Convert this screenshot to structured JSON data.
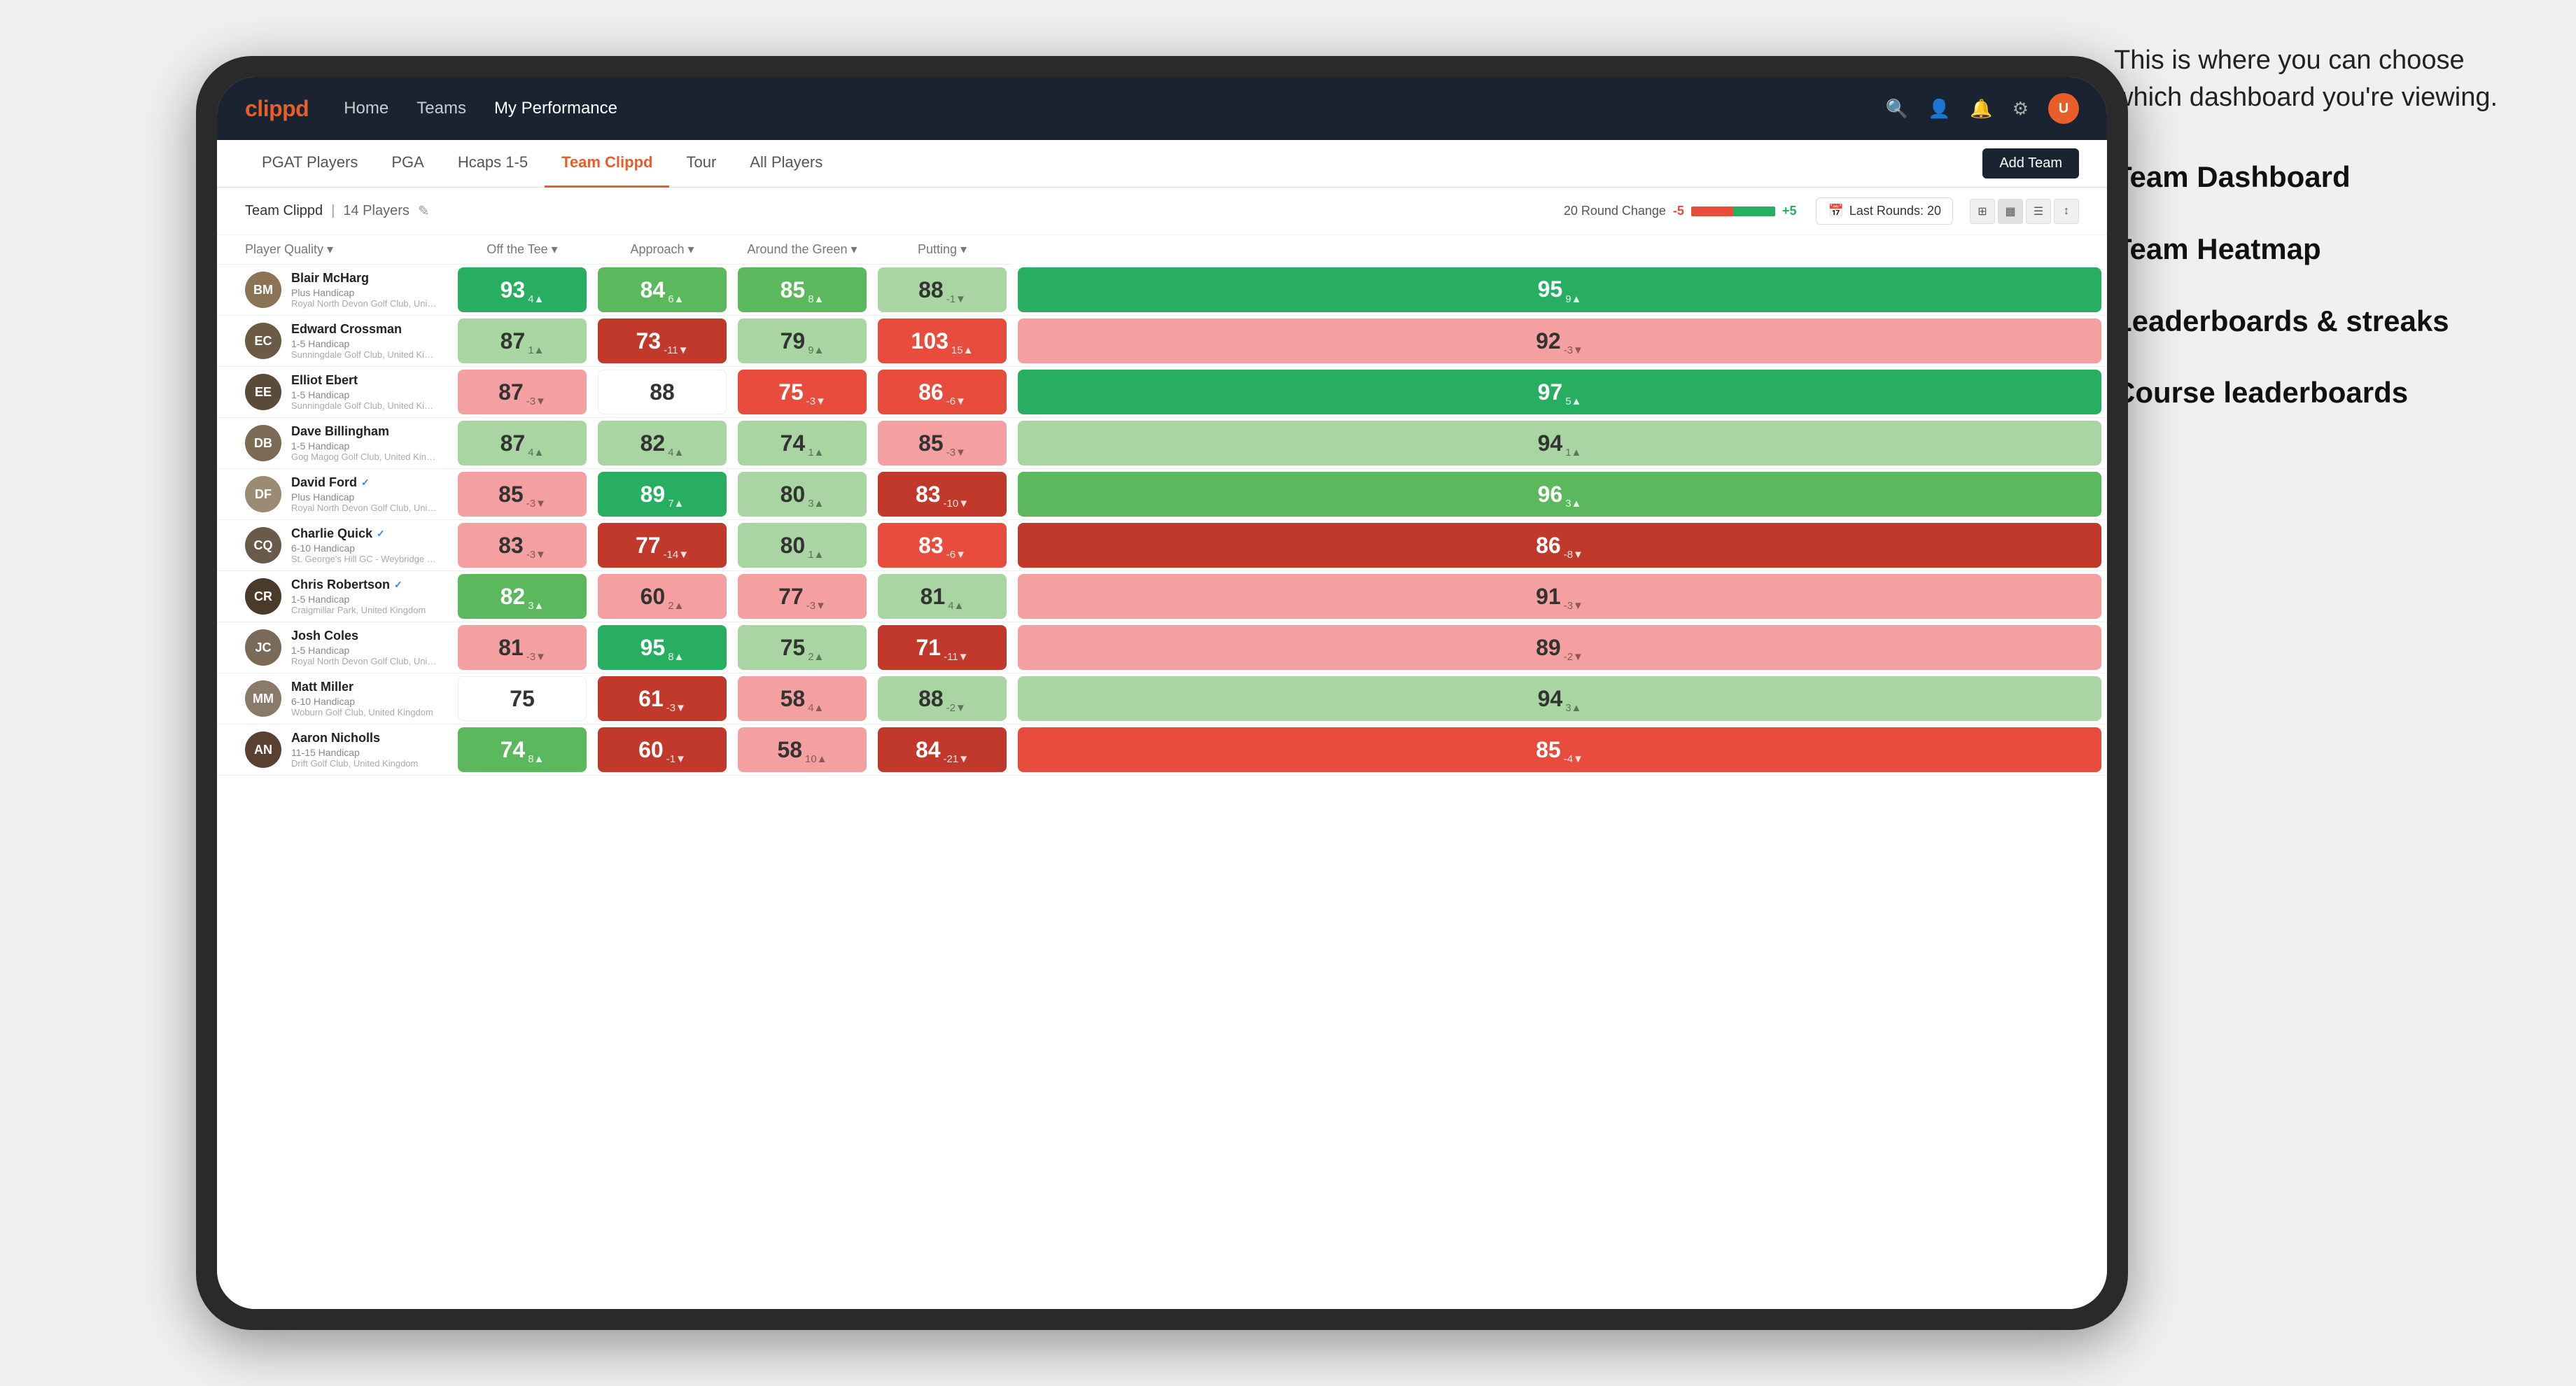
{
  "annotation": {
    "intro_text": "This is where you can choose which dashboard you're viewing.",
    "options": [
      "Team Dashboard",
      "Team Heatmap",
      "Leaderboards & streaks",
      "Course leaderboards"
    ]
  },
  "nav": {
    "logo": "clippd",
    "links": [
      "Home",
      "Teams",
      "My Performance"
    ],
    "active_link": "My Performance",
    "icons": [
      "🔍",
      "👤",
      "🔔",
      "⚙"
    ]
  },
  "sub_nav": {
    "tabs": [
      "PGAT Players",
      "PGA",
      "Hcaps 1-5",
      "Team Clippd",
      "Tour",
      "All Players"
    ],
    "active_tab": "Team Clippd",
    "add_team_label": "Add Team"
  },
  "team_bar": {
    "team_name": "Team Clippd",
    "separator": "|",
    "players_count": "14 Players",
    "round_change_label": "20 Round Change",
    "round_neg": "-5",
    "round_pos": "+5",
    "last_rounds_label": "Last Rounds:",
    "last_rounds_count": "20"
  },
  "table": {
    "headers": [
      {
        "label": "Player Quality ▾",
        "key": "player_quality"
      },
      {
        "label": "Off the Tee ▾",
        "key": "off_tee"
      },
      {
        "label": "Approach ▾",
        "key": "approach"
      },
      {
        "label": "Around the Green ▾",
        "key": "around_green"
      },
      {
        "label": "Putting ▾",
        "key": "putting"
      }
    ],
    "players": [
      {
        "name": "Blair McHarg",
        "handicap": "Plus Handicap",
        "club": "Royal North Devon Golf Club, United Kingdom",
        "verified": false,
        "avatar_color": "#8B7355",
        "scores": [
          {
            "value": "93",
            "change": "4▲",
            "color": "green-strong"
          },
          {
            "value": "84",
            "change": "6▲",
            "color": "green-mid"
          },
          {
            "value": "85",
            "change": "8▲",
            "color": "green-mid"
          },
          {
            "value": "88",
            "change": "-1▼",
            "color": "green-light"
          },
          {
            "value": "95",
            "change": "9▲",
            "color": "green-strong"
          }
        ]
      },
      {
        "name": "Edward Crossman",
        "handicap": "1-5 Handicap",
        "club": "Sunningdale Golf Club, United Kingdom",
        "verified": false,
        "avatar_color": "#6B5B45",
        "scores": [
          {
            "value": "87",
            "change": "1▲",
            "color": "green-light"
          },
          {
            "value": "73",
            "change": "-11▼",
            "color": "red-strong"
          },
          {
            "value": "79",
            "change": "9▲",
            "color": "green-light"
          },
          {
            "value": "103",
            "change": "15▲",
            "color": "red-mid"
          },
          {
            "value": "92",
            "change": "-3▼",
            "color": "red-light"
          }
        ]
      },
      {
        "name": "Elliot Ebert",
        "handicap": "1-5 Handicap",
        "club": "Sunningdale Golf Club, United Kingdom",
        "verified": false,
        "avatar_color": "#5a4a3a",
        "scores": [
          {
            "value": "87",
            "change": "-3▼",
            "color": "red-light"
          },
          {
            "value": "88",
            "change": "",
            "color": "white"
          },
          {
            "value": "75",
            "change": "-3▼",
            "color": "red-mid"
          },
          {
            "value": "86",
            "change": "-6▼",
            "color": "red-mid"
          },
          {
            "value": "97",
            "change": "5▲",
            "color": "green-strong"
          }
        ]
      },
      {
        "name": "Dave Billingham",
        "handicap": "1-5 Handicap",
        "club": "Gog Magog Golf Club, United Kingdom",
        "verified": false,
        "avatar_color": "#7B6B55",
        "scores": [
          {
            "value": "87",
            "change": "4▲",
            "color": "green-light"
          },
          {
            "value": "82",
            "change": "4▲",
            "color": "green-light"
          },
          {
            "value": "74",
            "change": "1▲",
            "color": "green-light"
          },
          {
            "value": "85",
            "change": "-3▼",
            "color": "red-light"
          },
          {
            "value": "94",
            "change": "1▲",
            "color": "green-light"
          }
        ]
      },
      {
        "name": "David Ford",
        "handicap": "Plus Handicap",
        "club": "Royal North Devon Golf Club, United Kingdom",
        "verified": true,
        "avatar_color": "#9B8B75",
        "scores": [
          {
            "value": "85",
            "change": "-3▼",
            "color": "red-light"
          },
          {
            "value": "89",
            "change": "7▲",
            "color": "green-strong"
          },
          {
            "value": "80",
            "change": "3▲",
            "color": "green-light"
          },
          {
            "value": "83",
            "change": "-10▼",
            "color": "red-strong"
          },
          {
            "value": "96",
            "change": "3▲",
            "color": "green-mid"
          }
        ]
      },
      {
        "name": "Charlie Quick",
        "handicap": "6-10 Handicap",
        "club": "St. George's Hill GC - Weybridge - Surrey, Uni...",
        "verified": true,
        "avatar_color": "#6a5a4a",
        "scores": [
          {
            "value": "83",
            "change": "-3▼",
            "color": "red-light"
          },
          {
            "value": "77",
            "change": "-14▼",
            "color": "red-strong"
          },
          {
            "value": "80",
            "change": "1▲",
            "color": "green-light"
          },
          {
            "value": "83",
            "change": "-6▼",
            "color": "red-mid"
          },
          {
            "value": "86",
            "change": "-8▼",
            "color": "red-strong"
          }
        ]
      },
      {
        "name": "Chris Robertson",
        "handicap": "1-5 Handicap",
        "club": "Craigmillar Park, United Kingdom",
        "verified": true,
        "avatar_color": "#4a3a2a",
        "scores": [
          {
            "value": "82",
            "change": "3▲",
            "color": "green-mid"
          },
          {
            "value": "60",
            "change": "2▲",
            "color": "red-light"
          },
          {
            "value": "77",
            "change": "-3▼",
            "color": "red-light"
          },
          {
            "value": "81",
            "change": "4▲",
            "color": "green-light"
          },
          {
            "value": "91",
            "change": "-3▼",
            "color": "red-light"
          }
        ]
      },
      {
        "name": "Josh Coles",
        "handicap": "1-5 Handicap",
        "club": "Royal North Devon Golf Club, United Kingdom",
        "verified": false,
        "avatar_color": "#7a6a5a",
        "scores": [
          {
            "value": "81",
            "change": "-3▼",
            "color": "red-light"
          },
          {
            "value": "95",
            "change": "8▲",
            "color": "green-strong"
          },
          {
            "value": "75",
            "change": "2▲",
            "color": "green-light"
          },
          {
            "value": "71",
            "change": "-11▼",
            "color": "red-strong"
          },
          {
            "value": "89",
            "change": "-2▼",
            "color": "red-light"
          }
        ]
      },
      {
        "name": "Matt Miller",
        "handicap": "6-10 Handicap",
        "club": "Woburn Golf Club, United Kingdom",
        "verified": false,
        "avatar_color": "#8a7a6a",
        "scores": [
          {
            "value": "75",
            "change": "",
            "color": "white"
          },
          {
            "value": "61",
            "change": "-3▼",
            "color": "red-strong"
          },
          {
            "value": "58",
            "change": "4▲",
            "color": "red-light"
          },
          {
            "value": "88",
            "change": "-2▼",
            "color": "green-light"
          },
          {
            "value": "94",
            "change": "3▲",
            "color": "green-light"
          }
        ]
      },
      {
        "name": "Aaron Nicholls",
        "handicap": "11-15 Handicap",
        "club": "Drift Golf Club, United Kingdom",
        "verified": false,
        "avatar_color": "#5a4030",
        "scores": [
          {
            "value": "74",
            "change": "8▲",
            "color": "green-mid"
          },
          {
            "value": "60",
            "change": "-1▼",
            "color": "red-strong"
          },
          {
            "value": "58",
            "change": "10▲",
            "color": "red-light"
          },
          {
            "value": "84",
            "change": "-21▼",
            "color": "red-strong"
          },
          {
            "value": "85",
            "change": "-4▼",
            "color": "red-mid"
          }
        ]
      }
    ]
  }
}
